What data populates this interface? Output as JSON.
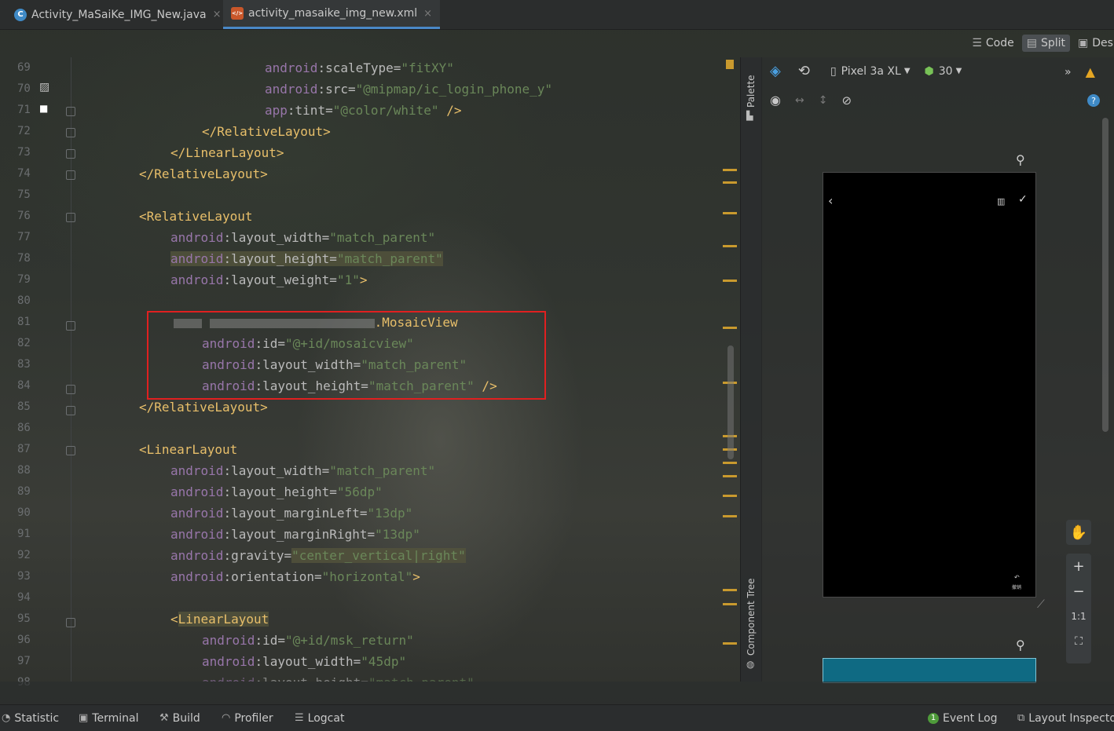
{
  "tabs": [
    {
      "label": "Activity_MaSaiKe_IMG_New.java",
      "icon": "C",
      "close": "×"
    },
    {
      "label": "activity_masaike_img_new.xml",
      "icon": "xml",
      "close": "×"
    }
  ],
  "view_modes": {
    "code": "Code",
    "split": "Split",
    "design": "Design"
  },
  "line_numbers": [
    "69",
    "70",
    "71",
    "72",
    "73",
    "74",
    "75",
    "76",
    "77",
    "78",
    "79",
    "80",
    "81",
    "82",
    "83",
    "84",
    "85",
    "86",
    "87",
    "88",
    "89",
    "90",
    "91",
    "92",
    "93",
    "94",
    "95",
    "96",
    "97",
    "98"
  ],
  "code": {
    "l69": {
      "ns": "android",
      "attr": ":scaleType=",
      "val": "\"fitXY\""
    },
    "l70": {
      "ns": "android",
      "attr": ":src=",
      "val": "\"@mipmap/ic_login_phone_y\""
    },
    "l71": {
      "ns": "app",
      "attr": ":tint=",
      "val": "\"@color/white\"",
      "end": " />"
    },
    "l72": "</RelativeLayout>",
    "l73": "</LinearLayout>",
    "l74": "</RelativeLayout>",
    "l76": "<RelativeLayout",
    "l77": {
      "ns": "android",
      "attr": ":layout_width=",
      "val": "\"match_parent\""
    },
    "l78": {
      "ns": "android",
      "attr": ":layout_height=",
      "val": "\"match_parent\""
    },
    "l79": {
      "ns": "android",
      "attr": ":layout_weight=",
      "val": "\"1\"",
      "end": ">"
    },
    "l81": ".MosaicView",
    "l82": {
      "ns": "android",
      "attr": ":id=",
      "val": "\"@+id/mosaicview\""
    },
    "l83": {
      "ns": "android",
      "attr": ":layout_width=",
      "val": "\"match_parent\""
    },
    "l84": {
      "ns": "android",
      "attr": ":layout_height=",
      "val": "\"match_parent\"",
      "end": " />"
    },
    "l85": "</RelativeLayout>",
    "l87": "<LinearLayout",
    "l88": {
      "ns": "android",
      "attr": ":layout_width=",
      "val": "\"match_parent\""
    },
    "l89": {
      "ns": "android",
      "attr": ":layout_height=",
      "val": "\"56dp\""
    },
    "l90": {
      "ns": "android",
      "attr": ":layout_marginLeft=",
      "val": "\"13dp\""
    },
    "l91": {
      "ns": "android",
      "attr": ":layout_marginRight=",
      "val": "\"13dp\""
    },
    "l92": {
      "ns": "android",
      "attr": ":gravity=",
      "val": "\"center_vertical|right\""
    },
    "l93": {
      "ns": "android",
      "attr": ":orientation=",
      "val": "\"horizontal\"",
      "end": ">"
    },
    "l95_open": "<",
    "l95_tag": "LinearLayout",
    "l96": {
      "ns": "android",
      "attr": ":id=",
      "val": "\"@+id/msk_return\""
    },
    "l97": {
      "ns": "android",
      "attr": ":layout_width=",
      "val": "\"45dp\""
    },
    "l98": {
      "ns": "android",
      "attr": ":layout_height=",
      "val": "\"match_parent\""
    }
  },
  "side_panels": {
    "palette": "Palette",
    "component_tree": "Component Tree"
  },
  "design_toolbar": {
    "device": "Pixel 3a XL",
    "api": "30",
    "more": "»"
  },
  "phone_preview": {
    "back": "‹",
    "check": "✓",
    "undo_label": "撤销"
  },
  "zoom": {
    "plus": "+",
    "minus": "−",
    "one_to_one": "1:1"
  },
  "bottom_bar": {
    "statistic": "Statistic",
    "terminal": "Terminal",
    "build": "Build",
    "profiler": "Profiler",
    "logcat": "Logcat",
    "event_log_count": "1",
    "event_log": "Event Log",
    "layout_inspector": "Layout Inspector"
  },
  "colors": {
    "tag": "#e8bf6a",
    "namespace": "#9876aa",
    "string": "#6a8759",
    "highlight_box": "#e02020",
    "accent": "#4a88c7"
  }
}
